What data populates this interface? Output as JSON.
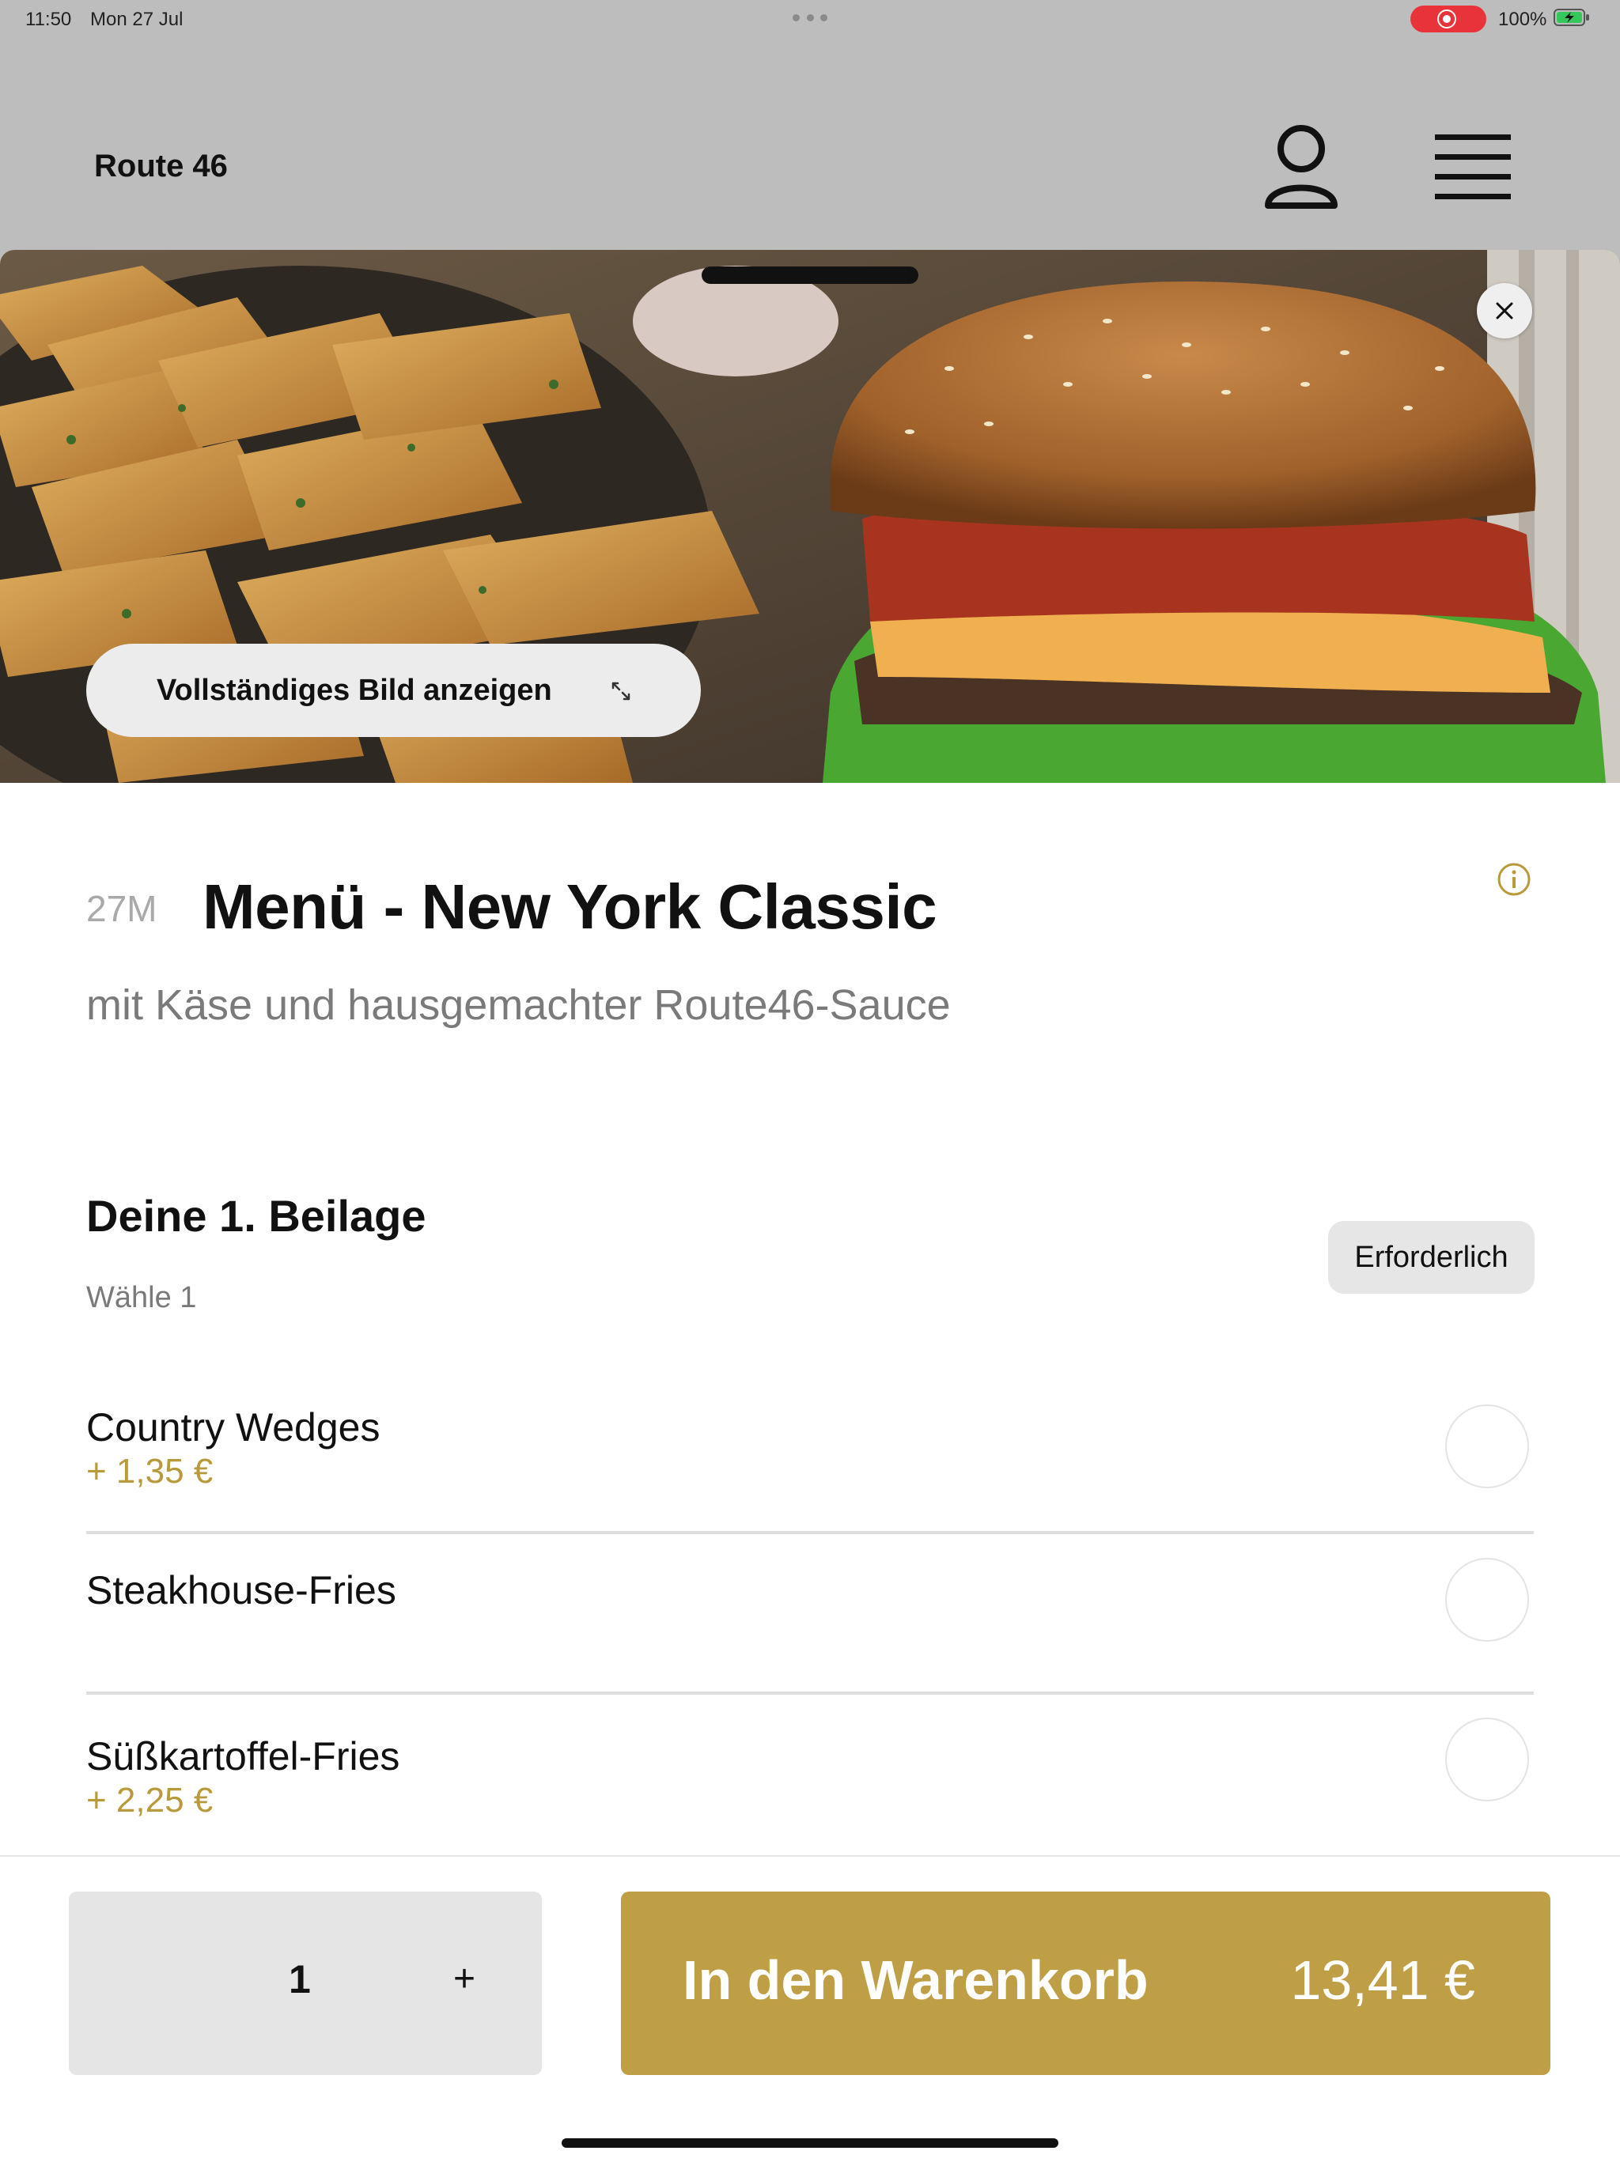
{
  "status_bar": {
    "time": "11:50",
    "date": "Mon 27 Jul",
    "battery": "100%"
  },
  "header": {
    "title": "Route 46",
    "profile_icon": "person-icon",
    "menu_icon": "hamburger-icon"
  },
  "hero": {
    "full_image_label": "Vollständiges Bild anzeigen",
    "close_icon": "close-icon",
    "expand_icon": "expand-icon"
  },
  "item": {
    "code": "27M",
    "title": "Menü - New York Classic",
    "description": "mit Käse und hausgemachter Route46-Sauce"
  },
  "section": {
    "title": "Deine 1. Beilage",
    "subtitle": "Wähle 1",
    "badge": "Erforderlich",
    "options": [
      {
        "name": "Country Wedges",
        "price": "+ 1,35 €"
      },
      {
        "name": "Steakhouse-Fries",
        "price": ""
      },
      {
        "name": "Süßkartoffel-Fries",
        "price": "+ 2,25 €"
      }
    ]
  },
  "footer": {
    "quantity": "1",
    "plus": "+",
    "cart_label": "In den Warenkorb",
    "cart_price": "13,41 €"
  },
  "colors": {
    "accent": "#bf9f45",
    "price": "#b89a3a",
    "overlay_bg": "#bdbdbd"
  }
}
